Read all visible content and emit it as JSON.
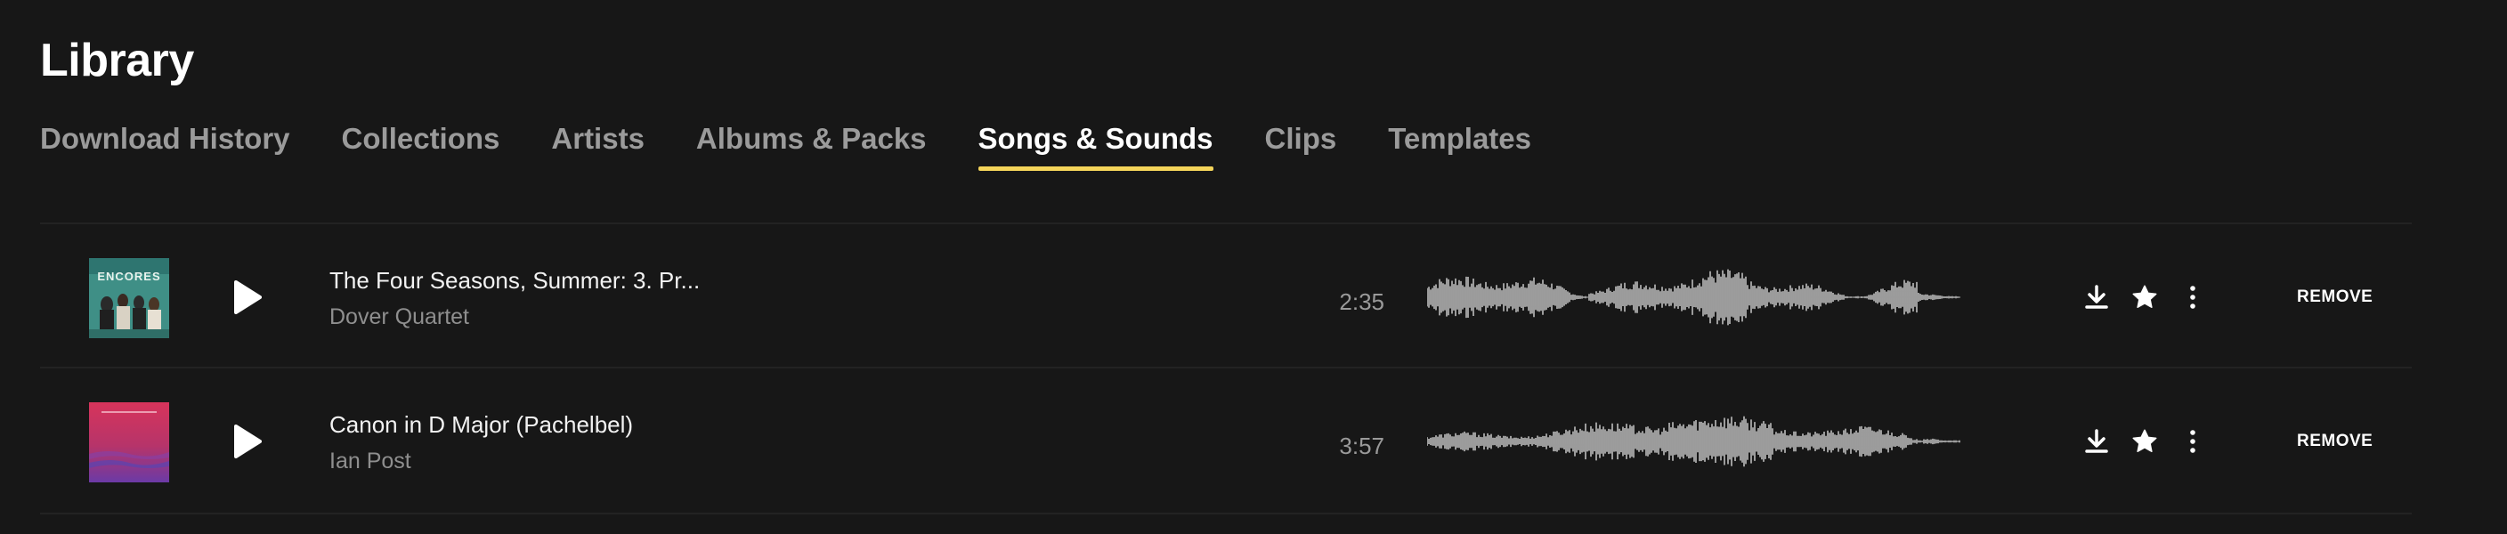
{
  "page": {
    "title": "Library"
  },
  "tabs": [
    {
      "label": "Download History",
      "active": false
    },
    {
      "label": "Collections",
      "active": false
    },
    {
      "label": "Artists",
      "active": false
    },
    {
      "label": "Albums & Packs",
      "active": false
    },
    {
      "label": "Songs & Sounds",
      "active": true
    },
    {
      "label": "Clips",
      "active": false
    },
    {
      "label": "Templates",
      "active": false
    }
  ],
  "colors": {
    "background": "#171717",
    "active_tab_underline": "#f4d45a",
    "muted_text": "#9b9b9b"
  },
  "tracks": [
    {
      "title": "The Four Seasons, Summer: 3. Pr...",
      "artist": "Dover Quartet",
      "duration": "2:35",
      "art_text": "ENCORES",
      "remove_label": "REMOVE",
      "icons": [
        "play-icon",
        "download-icon",
        "star-icon",
        "more-vertical-icon"
      ]
    },
    {
      "title": "Canon in D Major (Pachelbel)",
      "artist": "Ian Post",
      "duration": "3:57",
      "art_text": "",
      "remove_label": "REMOVE",
      "icons": [
        "play-icon",
        "download-icon",
        "star-icon",
        "more-vertical-icon"
      ]
    }
  ]
}
